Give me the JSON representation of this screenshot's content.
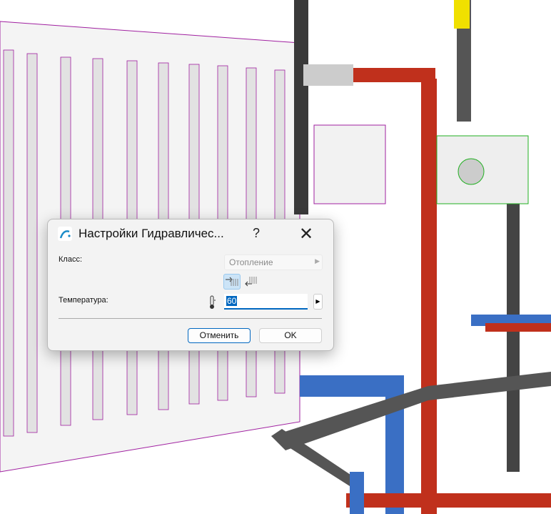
{
  "dialog": {
    "title": "Настройки Гидравличес...",
    "help_label": "?",
    "close_label": "✕",
    "class_label": "Класс:",
    "class_value": "Отопление",
    "temperature_label": "Температура:",
    "temperature_value": "60",
    "cancel_label": "Отменить",
    "ok_label": "OK"
  },
  "colors": {
    "accent": "#0067c0",
    "supply_pipe": "#c0301c",
    "return_pipe": "#3a6fc4",
    "outline": "#b000b0"
  }
}
